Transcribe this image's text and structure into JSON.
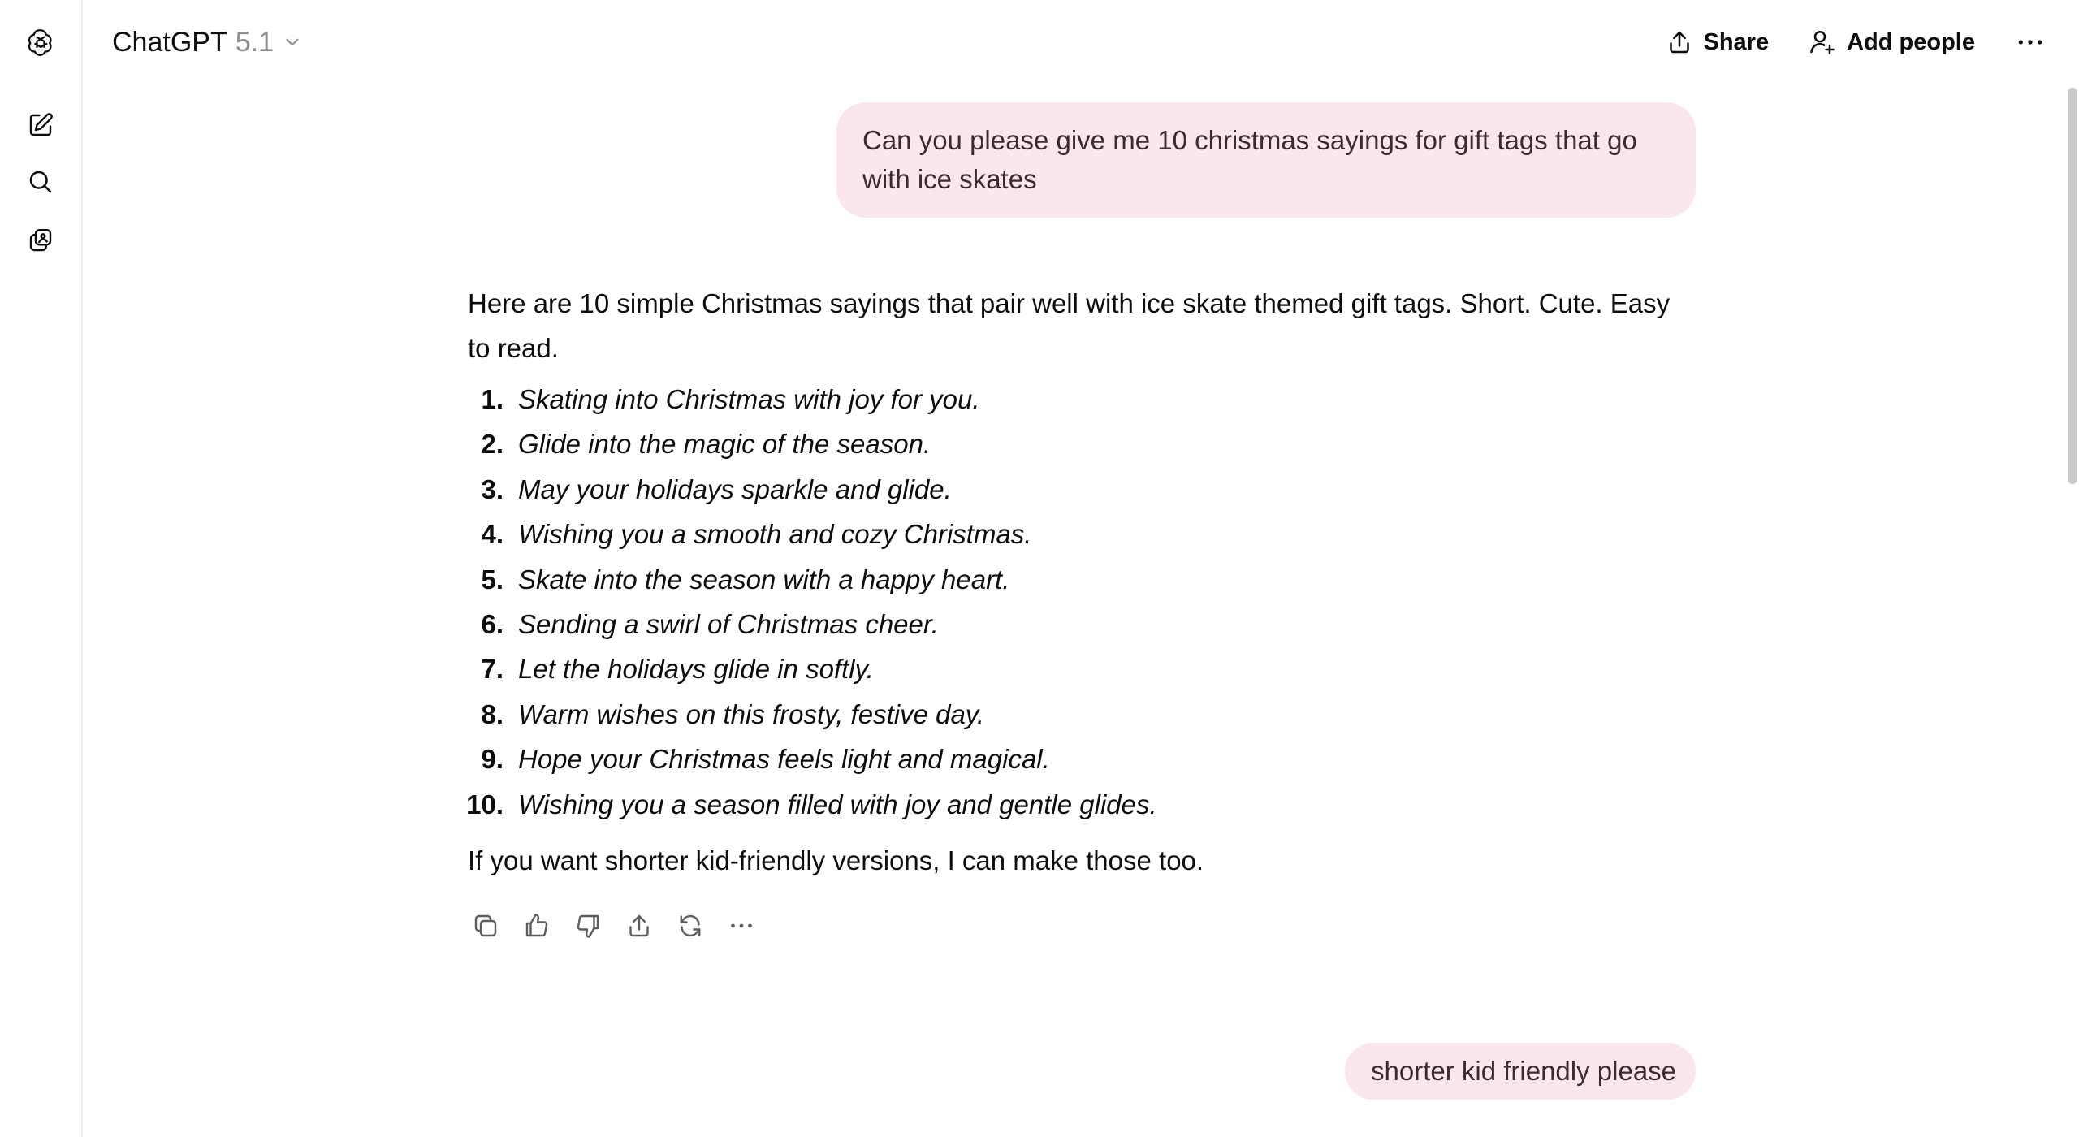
{
  "header": {
    "model_name": "ChatGPT",
    "model_version": "5.1",
    "share_label": "Share",
    "add_people_label": "Add people"
  },
  "sidebar": {
    "icons": [
      "openai-logo-icon",
      "new-chat-icon",
      "search-icon",
      "library-icon"
    ]
  },
  "conversation": {
    "user_message_1": "Can you please give me 10 christmas sayings for gift tags that go with ice skates",
    "assistant_intro": "Here are 10 simple Christmas sayings that pair well with ice skate themed gift tags. Short. Cute. Easy to read.",
    "sayings": [
      {
        "num": "1.",
        "text": "Skating into Christmas with joy for you."
      },
      {
        "num": "2.",
        "text": "Glide into the magic of the season."
      },
      {
        "num": "3.",
        "text": "May your holidays sparkle and glide."
      },
      {
        "num": "4.",
        "text": "Wishing you a smooth and cozy Christmas."
      },
      {
        "num": "5.",
        "text": "Skate into the season with a happy heart."
      },
      {
        "num": "6.",
        "text": "Sending a swirl of Christmas cheer."
      },
      {
        "num": "7.",
        "text": "Let the holidays glide in softly."
      },
      {
        "num": "8.",
        "text": "Warm wishes on this frosty, festive day."
      },
      {
        "num": "9.",
        "text": "Hope your Christmas feels light and magical."
      },
      {
        "num": "10.",
        "text": "Wishing you a season filled with joy and gentle glides."
      }
    ],
    "assistant_outro": "If you want shorter kid-friendly versions, I can make those too.",
    "user_message_2": "shorter kid friendly please"
  },
  "message_actions": [
    "copy-icon",
    "thumbs-up-icon",
    "thumbs-down-icon",
    "share-icon",
    "regenerate-icon",
    "more-icon"
  ],
  "colors": {
    "user_bubble": "#fbe6ef",
    "text": "#0d0d0d",
    "muted": "#8f8f8f"
  }
}
